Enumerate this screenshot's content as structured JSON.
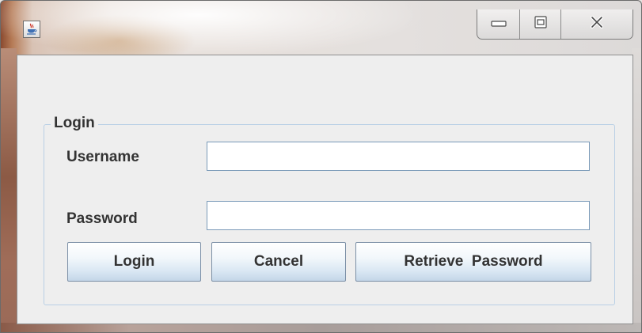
{
  "window": {
    "title": "",
    "icon": "java-cup-icon",
    "controls": {
      "minimize": "minimize-icon",
      "maximize": "maximize-icon",
      "close": "close-icon"
    }
  },
  "login_panel": {
    "legend": "Login",
    "username": {
      "label": "Username",
      "value": "",
      "placeholder": ""
    },
    "password": {
      "label": "Password",
      "value": "",
      "placeholder": ""
    },
    "buttons": {
      "login": "Login",
      "cancel": "Cancel",
      "retrieve_password": "Retrieve  Password"
    }
  },
  "colors": {
    "client_background": "#eeeeee",
    "fieldset_border": "#b8cfe5",
    "input_border": "#7a9ab8",
    "text": "#333333"
  }
}
